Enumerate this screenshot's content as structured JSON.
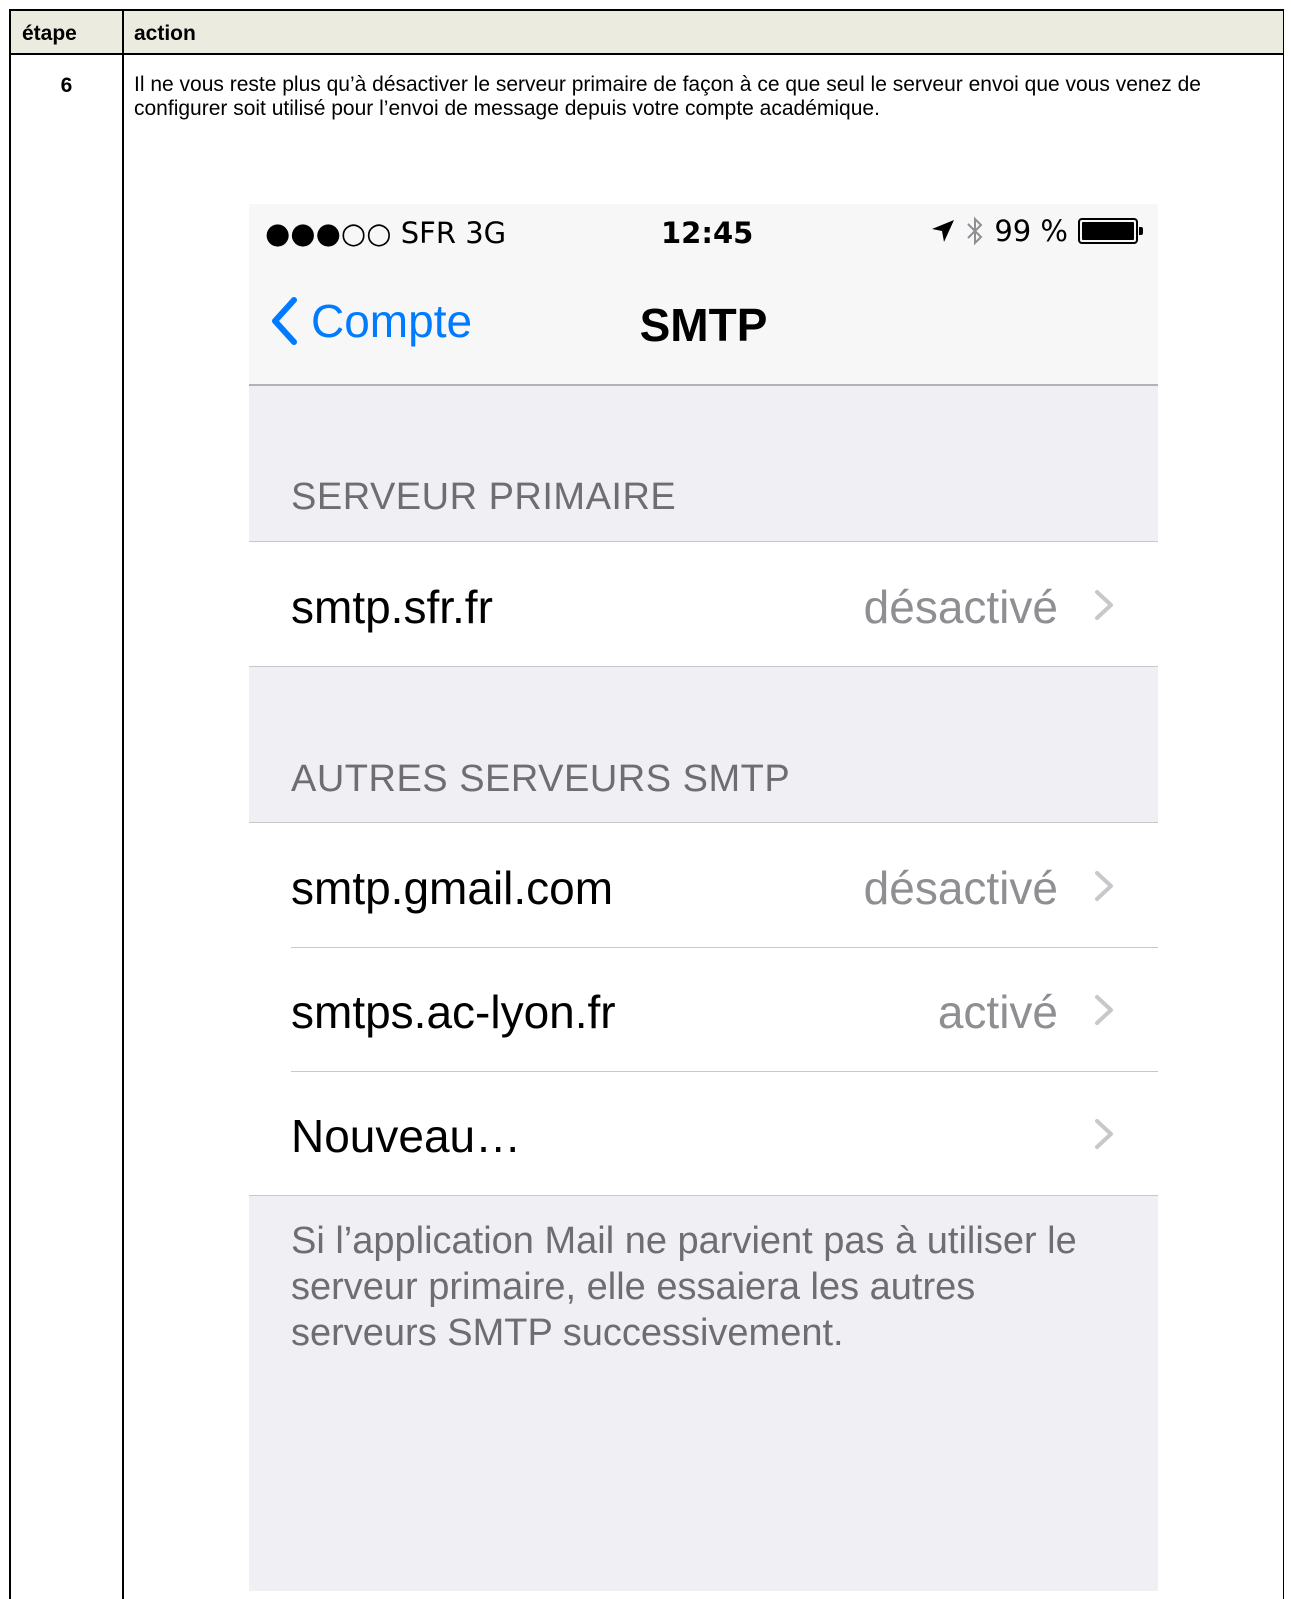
{
  "table": {
    "header_step": "étape",
    "header_action": "action",
    "step_number": "6",
    "action_text": "Il ne vous reste plus qu’à désactiver le serveur primaire de façon à ce que seul le serveur envoi que vous venez de configurer soit utilisé pour l’envoi de message depuis votre compte académique."
  },
  "phone": {
    "status": {
      "carrier": "●●●○○ SFR   3G",
      "time": "12:45",
      "battery": "99 %"
    },
    "nav": {
      "back_label": "Compte",
      "title": "SMTP"
    },
    "primary_section": {
      "header": "SERVEUR PRIMAIRE",
      "rows": [
        {
          "label": "smtp.sfr.fr",
          "value": "désactivé"
        }
      ]
    },
    "other_section": {
      "header": "AUTRES SERVEURS SMTP",
      "rows": [
        {
          "label": "smtp.gmail.com",
          "value": "désactivé"
        },
        {
          "label": "smtps.ac-lyon.fr",
          "value": "activé"
        },
        {
          "label": "Nouveau…",
          "value": ""
        }
      ]
    },
    "footer": "Si l’application Mail ne parvient pas à utiliser le serveur primaire, elle essaiera les autres serveurs SMTP successivement.",
    "colors": {
      "accent": "#007aff",
      "background": "#efeff4",
      "secondary_text": "#8e8e93"
    }
  }
}
